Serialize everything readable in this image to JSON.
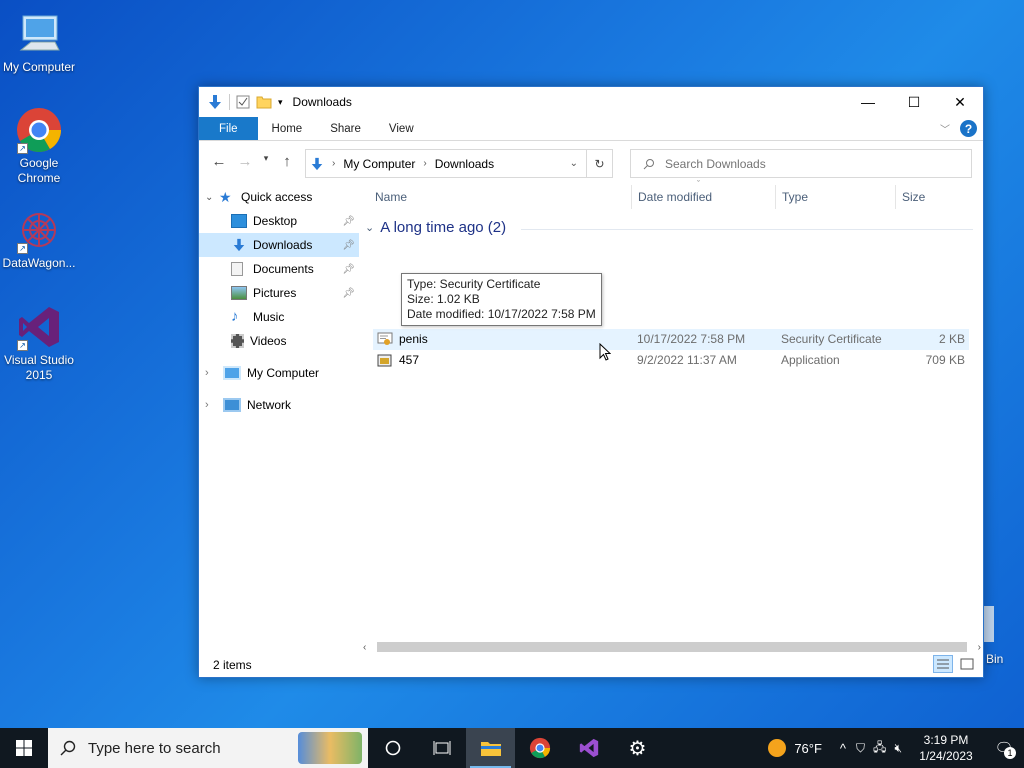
{
  "desktop": {
    "icons": [
      {
        "label": "My Computer"
      },
      {
        "label": "Google Chrome"
      },
      {
        "label": "DataWagon..."
      },
      {
        "label": "Visual Studio 2015"
      }
    ],
    "recycle_partial_label": "Bin"
  },
  "window": {
    "title": "Downloads",
    "ribbon_tabs": {
      "file": "File",
      "home": "Home",
      "share": "Share",
      "view": "View"
    },
    "help": "?",
    "address": {
      "crumbs": [
        "My Computer",
        "Downloads"
      ]
    },
    "search": {
      "placeholder": "Search Downloads"
    },
    "nav": {
      "quick_access": "Quick access",
      "items": [
        "Desktop",
        "Downloads",
        "Documents",
        "Pictures",
        "Music",
        "Videos"
      ],
      "my_computer": "My Computer",
      "network": "Network"
    },
    "columns": {
      "name": "Name",
      "date": "Date modified",
      "type": "Type",
      "size": "Size"
    },
    "group_label": "A long time ago (2)",
    "files": [
      {
        "name": "penis",
        "date": "10/17/2022 7:58 PM",
        "type": "Security Certificate",
        "size": "2 KB"
      },
      {
        "name": "457",
        "date": "9/2/2022 11:37 AM",
        "type": "Application",
        "size": "709 KB"
      }
    ],
    "tooltip": {
      "type": "Type: Security Certificate",
      "size": "Size: 1.02 KB",
      "date": "Date modified: 10/17/2022 7:58 PM"
    },
    "status": "2 items"
  },
  "taskbar": {
    "search_placeholder": "Type here to search",
    "weather": "76°F",
    "time": "3:19 PM",
    "date": "1/24/2023",
    "notif_count": "1"
  },
  "colors": {
    "accent": "#1979ca",
    "selection": "#cce8ff",
    "hover": "#e5f3ff",
    "taskbar": "#101820"
  }
}
